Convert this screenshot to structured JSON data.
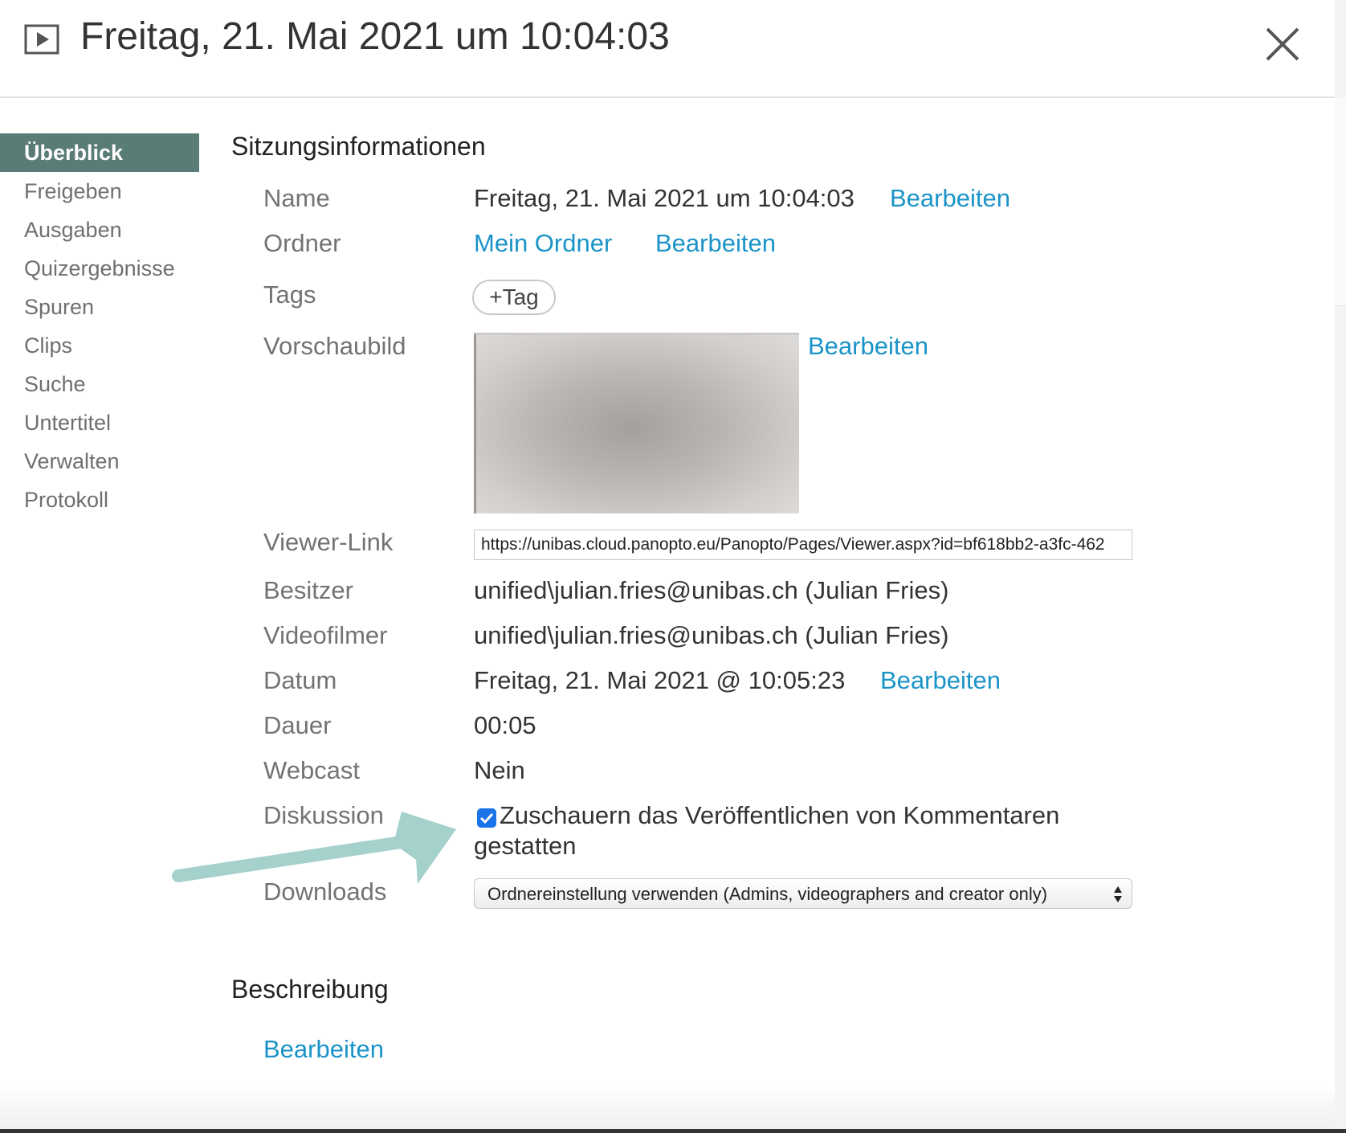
{
  "header": {
    "title": "Freitag, 21. Mai 2021 um 10:04:03"
  },
  "sidebar": {
    "items": [
      {
        "label": "Überblick",
        "active": true
      },
      {
        "label": "Freigeben"
      },
      {
        "label": "Ausgaben"
      },
      {
        "label": "Quizergebnisse"
      },
      {
        "label": "Spuren"
      },
      {
        "label": "Clips"
      },
      {
        "label": "Suche"
      },
      {
        "label": "Untertitel"
      },
      {
        "label": "Verwalten"
      },
      {
        "label": "Protokoll"
      }
    ]
  },
  "session": {
    "title": "Sitzungsinformationen",
    "edit_label": "Bearbeiten",
    "name": {
      "label": "Name",
      "value": "Freitag, 21. Mai 2021 um 10:04:03"
    },
    "folder": {
      "label": "Ordner",
      "value": "Mein Ordner"
    },
    "tags": {
      "label": "Tags",
      "button": "+Tag"
    },
    "thumbnail": {
      "label": "Vorschaubild"
    },
    "viewer_link": {
      "label": "Viewer-Link",
      "value": "https://unibas.cloud.panopto.eu/Panopto/Pages/Viewer.aspx?id=bf618bb2-a3fc-462"
    },
    "owner": {
      "label": "Besitzer",
      "value": "unified\\julian.fries@unibas.ch (Julian Fries)"
    },
    "videographer": {
      "label": "Videofilmer",
      "value": "unified\\julian.fries@unibas.ch (Julian Fries)"
    },
    "date": {
      "label": "Datum",
      "value": "Freitag, 21. Mai 2021 @ 10:05:23"
    },
    "duration": {
      "label": "Dauer",
      "value": "00:05"
    },
    "webcast": {
      "label": "Webcast",
      "value": "Nein"
    },
    "discussion": {
      "label": "Diskussion",
      "checked": true,
      "line1": "Zuschauern das Veröffentlichen von Kommentaren",
      "line2": "gestatten"
    },
    "downloads": {
      "label": "Downloads",
      "selected": "Ordnereinstellung verwenden (Admins, videographers and creator only)"
    }
  },
  "description": {
    "title": "Beschreibung",
    "edit_label": "Bearbeiten"
  },
  "colors": {
    "accent": "#5a7c77",
    "link": "#1a94c8",
    "arrow": "#a5d1cc",
    "checkbox": "#1a73e8"
  }
}
